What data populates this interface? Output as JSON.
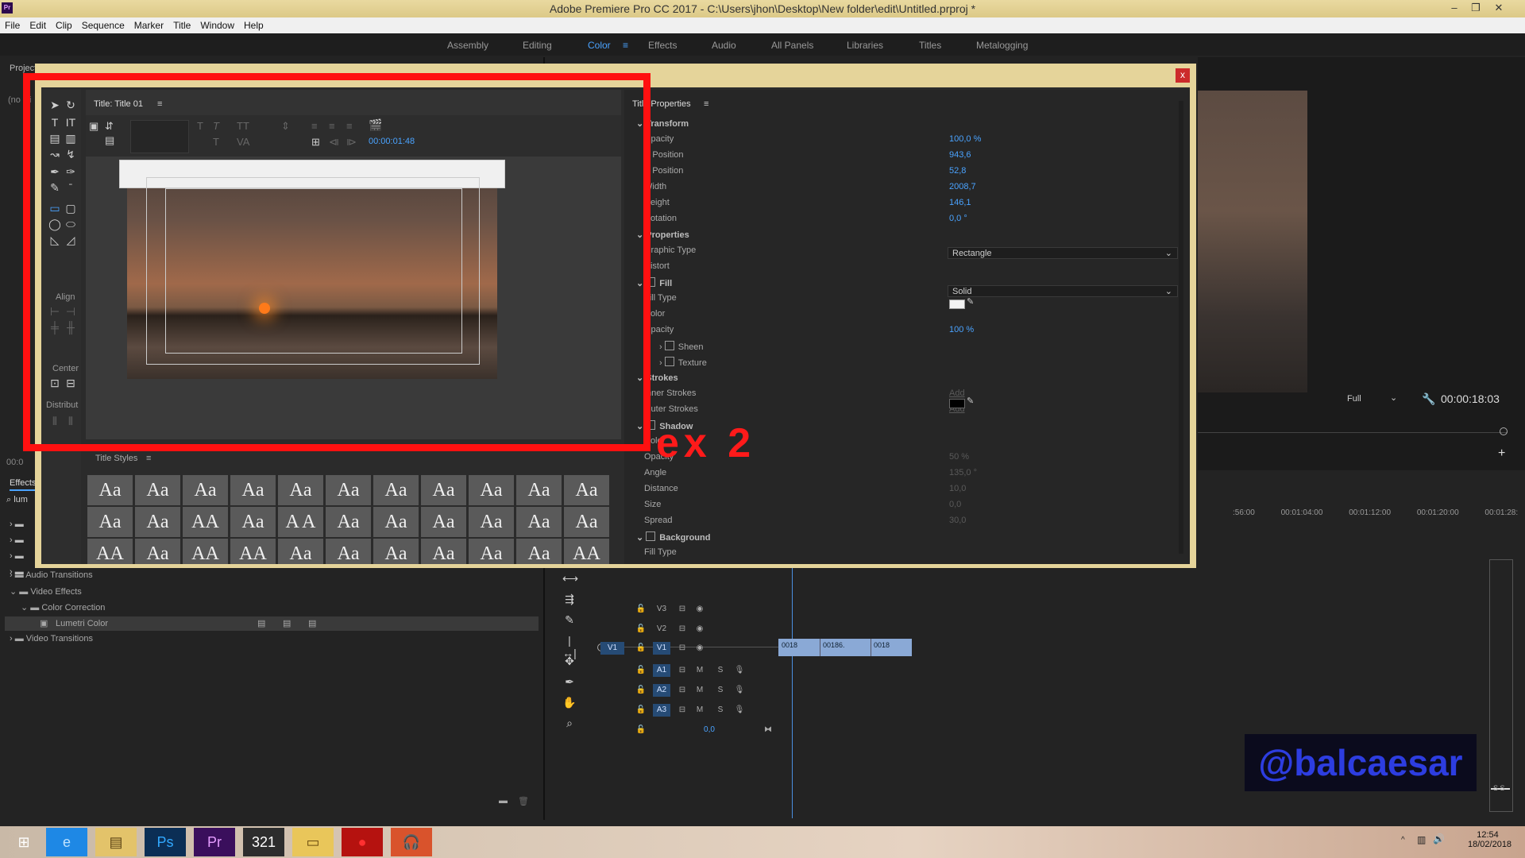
{
  "window": {
    "app_icon": "Pr",
    "title": "Adobe Premiere Pro CC 2017 - C:\\Users\\jhon\\Desktop\\New folder\\edit\\Untitled.prproj *",
    "minimize": "–",
    "restore": "❐",
    "close": "✕"
  },
  "menu": [
    "File",
    "Edit",
    "Clip",
    "Sequence",
    "Marker",
    "Title",
    "Window",
    "Help"
  ],
  "workspaces": [
    "Assembly",
    "Editing",
    "Color",
    "Effects",
    "Audio",
    "All Panels",
    "Libraries",
    "Titles",
    "Metalogging"
  ],
  "workspace_active": "Color",
  "workspace_active_icon": "≡",
  "left_panel": {
    "project_label": "Project",
    "project_sub": "(no cli",
    "effects_tab": "Effects",
    "search_value": "lum",
    "tree": [
      {
        "label": "Audio Transitions",
        "level": 0,
        "expanded": false
      },
      {
        "label": "Video Effects",
        "level": 0,
        "expanded": true
      },
      {
        "label": "Color Correction",
        "level": 1,
        "expanded": true
      },
      {
        "label": "Lumetri Color",
        "level": 2,
        "expanded": false,
        "selected": true
      },
      {
        "label": "Video Transitions",
        "level": 0,
        "expanded": false
      }
    ],
    "timecode_fragment": "00:0"
  },
  "title_dialog": {
    "close": "x",
    "title_tab": "Title: Title 01",
    "menu_icon": "≡",
    "timecode": "00:00:01:48",
    "align_label": "Align",
    "center_label": "Center",
    "distribute_label": "Distribut",
    "styles_tab": "Title Styles",
    "styles": [
      "Aa",
      "Aa",
      "Aa",
      "Aa",
      "Aa",
      "Aa",
      "Aa",
      "Aa",
      "Aa",
      "Aa",
      "Aa",
      "Aa",
      "Aa",
      "AA",
      "Aa",
      "A A",
      "Aa",
      "Aa",
      "Aa",
      "Aa",
      "Aa",
      "Aa",
      "AA",
      "Aa",
      "AA",
      "AA",
      "Aa",
      "Aa",
      "Aa",
      "Aa",
      "Aa",
      "Aa",
      "AA"
    ]
  },
  "title_properties": {
    "tab": "Title Properties",
    "rows": [
      {
        "label": "Transform",
        "section": true,
        "indent": 0,
        "value": ""
      },
      {
        "label": "Opacity",
        "indent": 1,
        "value": "100,0 %"
      },
      {
        "label": "X Position",
        "indent": 1,
        "value": "943,6"
      },
      {
        "label": "Y Position",
        "indent": 1,
        "value": "52,8"
      },
      {
        "label": "Width",
        "indent": 1,
        "value": "2008,7"
      },
      {
        "label": "Height",
        "indent": 1,
        "value": "146,1"
      },
      {
        "label": "Rotation",
        "indent": 1,
        "value": "0,0 °"
      },
      {
        "label": "Properties",
        "section": true,
        "indent": 0,
        "value": ""
      },
      {
        "label": "Graphic Type",
        "indent": 1,
        "value": ""
      },
      {
        "label": "Distort",
        "indent": 1,
        "value": ""
      },
      {
        "label": "Fill",
        "section": true,
        "indent": 0,
        "value": ""
      },
      {
        "label": "Fill Type",
        "indent": 1,
        "value": ""
      },
      {
        "label": "Color",
        "indent": 1,
        "value": ""
      },
      {
        "label": "Opacity",
        "indent": 1,
        "value": "100 %"
      },
      {
        "label": "Sheen",
        "indent": 2,
        "value": ""
      },
      {
        "label": "Texture",
        "indent": 2,
        "value": ""
      },
      {
        "label": "Strokes",
        "section": true,
        "indent": 0,
        "value": ""
      },
      {
        "label": "Inner Strokes",
        "indent": 1,
        "value": "Add"
      },
      {
        "label": "Outer Strokes",
        "indent": 1,
        "value": "Add"
      },
      {
        "label": "Shadow",
        "section": true,
        "indent": 0,
        "value": ""
      },
      {
        "label": "Color",
        "indent": 1,
        "value": ""
      },
      {
        "label": "Opacity",
        "indent": 1,
        "value": "50 %"
      },
      {
        "label": "Angle",
        "indent": 1,
        "value": "135,0 °"
      },
      {
        "label": "Distance",
        "indent": 1,
        "value": "10,0"
      },
      {
        "label": "Size",
        "indent": 1,
        "value": "0,0"
      },
      {
        "label": "Spread",
        "indent": 1,
        "value": "30,0"
      },
      {
        "label": "Background",
        "section": true,
        "indent": 0,
        "value": ""
      },
      {
        "label": "Fill Type",
        "indent": 1,
        "value": ""
      }
    ],
    "graphic_type_value": "Rectangle",
    "fill_type_value": "Solid",
    "fill_color": "#f2f2f2",
    "shadow_color": "#000000"
  },
  "annotation": {
    "label": "ex 2",
    "color": "#ff1a1a"
  },
  "program_monitor": {
    "zoom": "Full",
    "timecode": "00:00:18:03"
  },
  "timeline": {
    "ruler": [
      ":56:00",
      "00:01:04:00",
      "00:01:12:00",
      "00:01:20:00",
      "00:01:28:"
    ],
    "video_tracks": [
      {
        "source": "",
        "name": "V3"
      },
      {
        "source": "",
        "name": "V2"
      },
      {
        "source": "V1",
        "name": "V1"
      }
    ],
    "audio_tracks": [
      {
        "name": "A1",
        "m": "M",
        "s": "S"
      },
      {
        "name": "A2",
        "m": "M",
        "s": "S"
      },
      {
        "name": "A3",
        "m": "M",
        "s": "S"
      }
    ],
    "master_value": "0,0",
    "clips": [
      "0018",
      "00186.",
      "0018"
    ],
    "solo_meter": "S S"
  },
  "watermark": "@balcaesar",
  "taskbar": {
    "time": "12:54",
    "date": "18/02/2018",
    "apps": [
      "Start",
      "Internet Explorer",
      "File Explorer",
      "Photoshop",
      "Premiere Pro",
      "Media Player",
      "Folder",
      "Recorder",
      "Audio"
    ],
    "app_glyphs": [
      "⊞",
      "e",
      "▤",
      "Ps",
      "Pr",
      "321",
      "▭",
      "●",
      "🎧"
    ]
  }
}
